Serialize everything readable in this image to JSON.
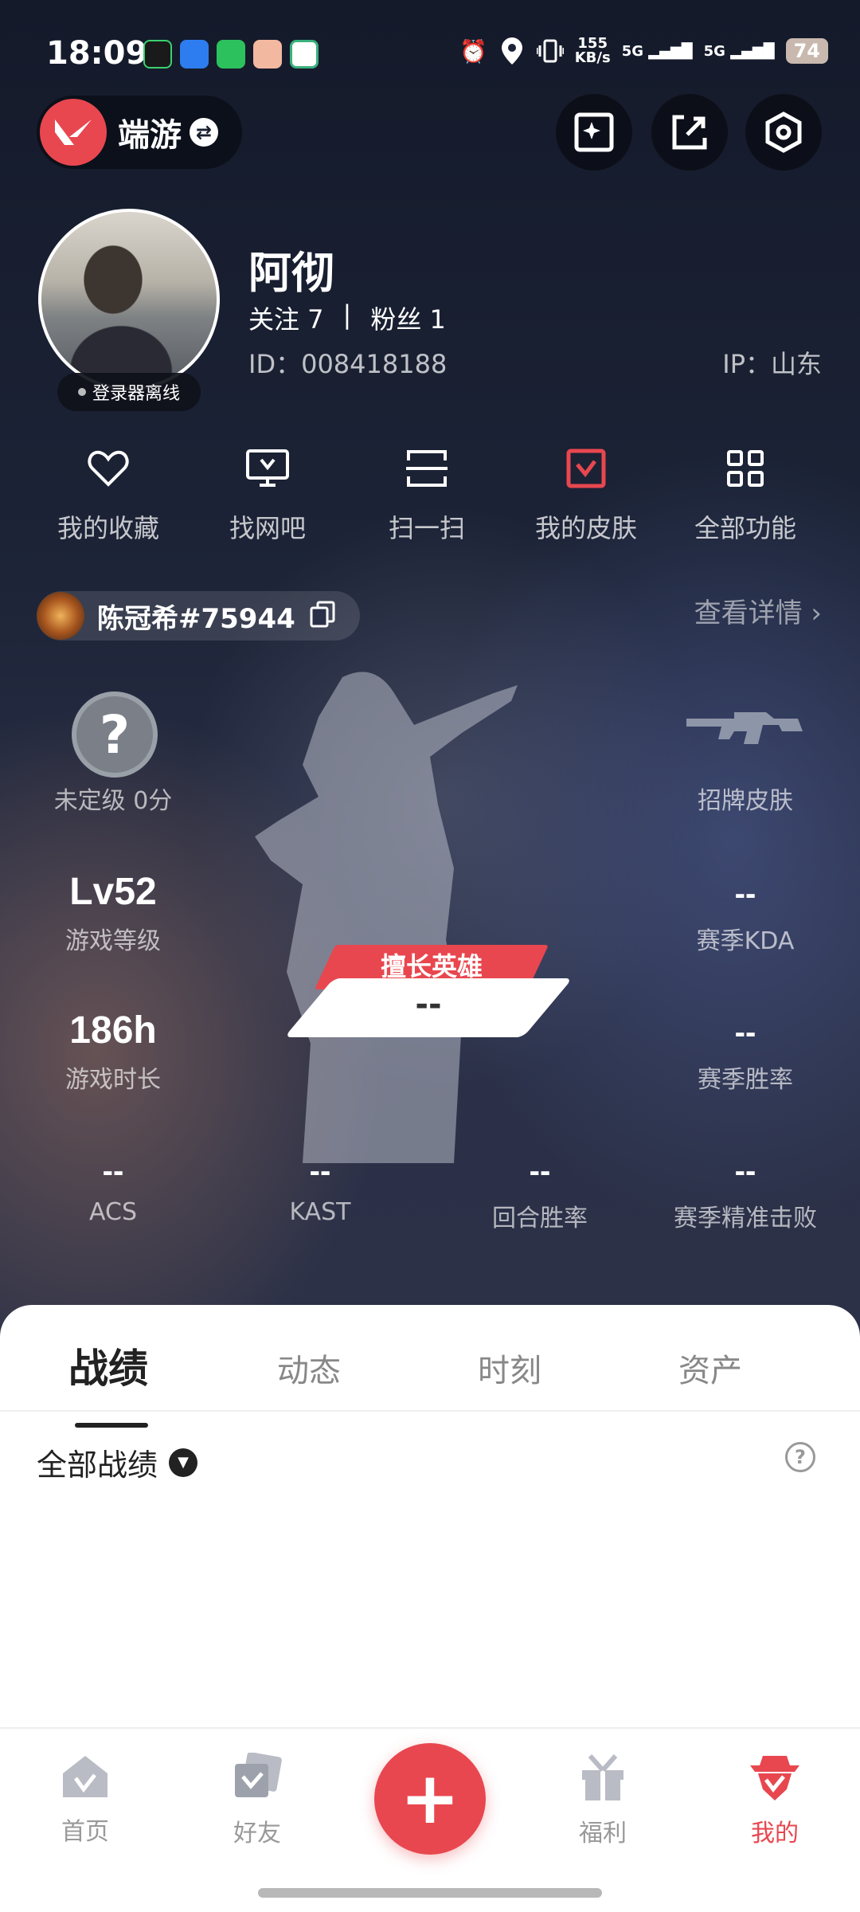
{
  "status_bar": {
    "time": "18:09",
    "net_speed_value": "155",
    "net_speed_unit": "KB/s",
    "signal_1": "5G",
    "signal_2": "5G",
    "battery": "74"
  },
  "header": {
    "game_name": "端游"
  },
  "profile": {
    "username": "阿彻",
    "follow_label": "关注 7",
    "separator": "|",
    "fans_label": "粉丝 1",
    "id_text": "ID：008418188",
    "ip_text": "IP：山东",
    "login_status": "登录器离线"
  },
  "quick_actions": [
    {
      "label": "我的收藏",
      "icon": "heart-icon"
    },
    {
      "label": "找网吧",
      "icon": "monitor-icon"
    },
    {
      "label": "扫一扫",
      "icon": "scan-icon"
    },
    {
      "label": "我的皮肤",
      "icon": "skin-icon"
    },
    {
      "label": "全部功能",
      "icon": "grid-icon"
    }
  ],
  "player": {
    "tag": "陈冠希#75944",
    "details_link": "查看详情"
  },
  "stats": {
    "rank_symbol": "?",
    "rank_label": "未定级 0分",
    "skin_label": "招牌皮肤",
    "level_value": "Lv52",
    "level_label": "游戏等级",
    "kda_value": "--",
    "kda_label": "赛季KDA",
    "hours_value": "186h",
    "hours_label": "游戏时长",
    "winrate_value": "--",
    "winrate_label": "赛季胜率",
    "acs_value": "--",
    "acs_label": "ACS",
    "kast_value": "--",
    "kast_label": "KAST",
    "round_value": "--",
    "round_label": "回合胜率",
    "precise_value": "--",
    "precise_label": "赛季精准击败",
    "best_hero_tag": "擅长英雄",
    "best_hero_value": "--"
  },
  "tabs": [
    {
      "label": "战绩",
      "active": true
    },
    {
      "label": "动态",
      "active": false
    },
    {
      "label": "时刻",
      "active": false
    },
    {
      "label": "资产",
      "active": false
    }
  ],
  "filter": {
    "label": "全部战绩"
  },
  "bottom_nav": [
    {
      "label": "首页",
      "icon": "home-icon"
    },
    {
      "label": "好友",
      "icon": "friends-icon"
    },
    {
      "label": "福利",
      "icon": "gift-icon"
    },
    {
      "label": "我的",
      "icon": "profile-icon"
    }
  ],
  "colors": {
    "accent": "#e8474f",
    "background_dark": "#1b2233"
  }
}
